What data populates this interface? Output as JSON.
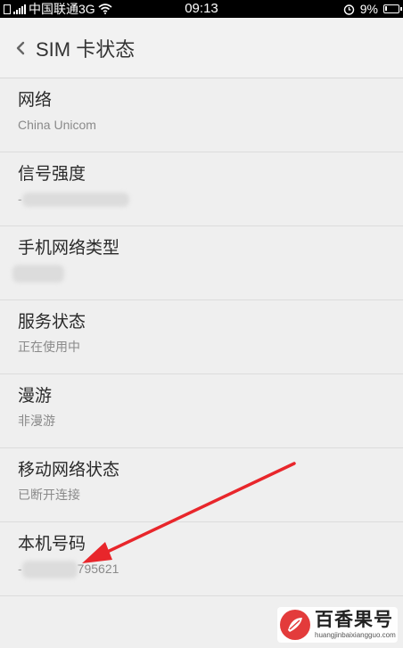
{
  "status_bar": {
    "carrier": "中国联通3G",
    "time": "09:13",
    "battery": "9%",
    "icons": [
      "sim-icon",
      "signal-icon",
      "wifi-icon",
      "alarm-icon",
      "battery-icon"
    ]
  },
  "header": {
    "back_icon": "chevron-left-icon",
    "title": "SIM 卡状态"
  },
  "items": [
    {
      "title": "网络",
      "value": "China Unicom"
    },
    {
      "title": "信号强度",
      "value_prefix": "-",
      "value_suffix": "",
      "value_redacted": true
    },
    {
      "title": "手机网络类型",
      "value_redacted": true
    },
    {
      "title": "服务状态",
      "value": "正在使用中"
    },
    {
      "title": "漫游",
      "value": "非漫游"
    },
    {
      "title": "移动网络状态",
      "value": "已断开连接"
    },
    {
      "title": "本机号码",
      "value_prefix": "-",
      "value_suffix": "795621",
      "value_redacted": true
    }
  ],
  "annotation": {
    "arrow_color": "#e8262b"
  },
  "watermark": {
    "name": "百香果号",
    "url": "huangjinbaixiangguo.com"
  }
}
